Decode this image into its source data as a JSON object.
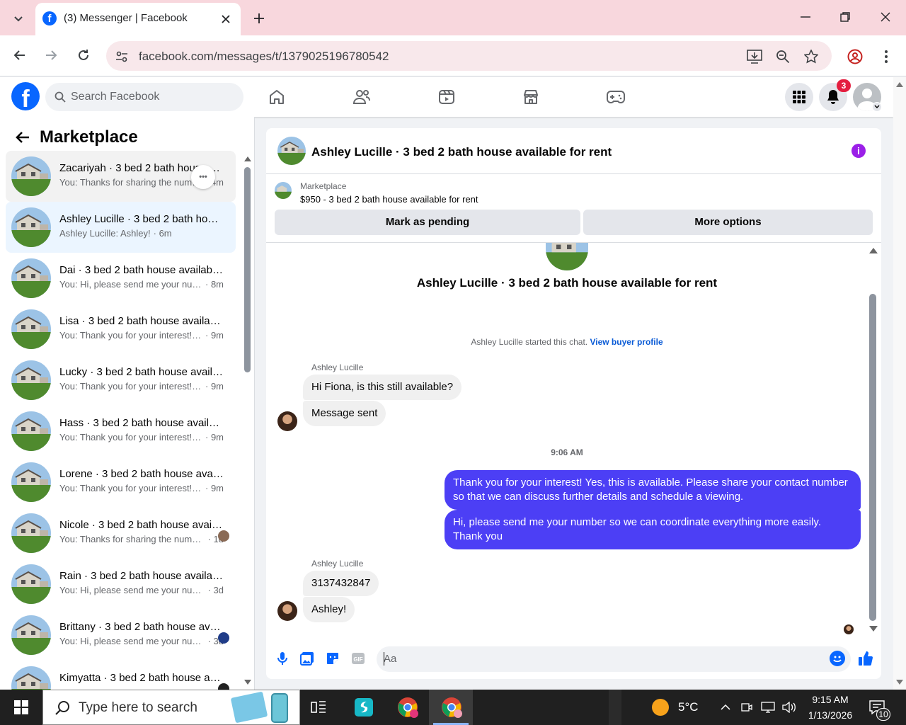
{
  "browser": {
    "tab_title": "(3) Messenger | Facebook",
    "url": "facebook.com/messages/t/1379025196780542"
  },
  "header": {
    "search_placeholder": "Search Facebook",
    "notification_count": "3"
  },
  "sidebar": {
    "title": "Marketplace",
    "conversations": [
      {
        "name": "Zacariyah · 3 bed 2 bath house available for rent",
        "snippet": "You: Thanks for sharing the number",
        "time": "· 4m",
        "active": false
      },
      {
        "name": "Ashley Lucille · 3 bed 2 bath house available for rent",
        "snippet": "Ashley Lucille: Ashley!",
        "time": "· 6m",
        "active": true
      },
      {
        "name": "Dai · 3 bed 2 bath house available for rent",
        "snippet": "You: Hi, please send me your number so we can coordinate",
        "time": "· 8m",
        "active": false
      },
      {
        "name": "Lisa · 3 bed 2 bath house available for rent",
        "snippet": "You: Thank you for your interest! Yes, this is available",
        "time": "· 9m",
        "active": false
      },
      {
        "name": "Lucky · 3 bed 2 bath house available for rent",
        "snippet": "You: Thank you for your interest! Yes, this is available",
        "time": "· 9m",
        "active": false
      },
      {
        "name": "Hass · 3 bed 2 bath house available for rent",
        "snippet": "You: Thank you for your interest! Yes, this is available",
        "time": "· 9m",
        "active": false
      },
      {
        "name": "Lorene · 3 bed 2 bath house available for rent",
        "snippet": "You: Thank you for your interest! Yes, this is available",
        "time": "· 9m",
        "active": false
      },
      {
        "name": "Nicole · 3 bed 2 bath house available for rent",
        "snippet": "You: Thanks for sharing the number",
        "time": "· 1d",
        "active": false
      },
      {
        "name": "Rain · 3 bed 2 bath house available for rent",
        "snippet": "You: Hi, please send me your number so we can coordinate",
        "time": "· 3d",
        "active": false
      },
      {
        "name": "Brittany · 3 bed 2 bath house available for rent",
        "snippet": "You: Hi, please send me your number so we can coordinate",
        "time": "· 3d",
        "active": false
      },
      {
        "name": "Kimyatta · 3 bed 2 bath house available for rent",
        "snippet": "",
        "time": "",
        "active": false
      }
    ]
  },
  "chat": {
    "title": "Ashley Lucille · 3 bed 2 bath house available for rent",
    "listing_label": "Marketplace",
    "listing_price_title": "$950 - 3 bed 2 bath house available for rent",
    "mark_pending": "Mark as pending",
    "more_options": "More options",
    "profile_title": "Ashley Lucille · 3 bed 2 bath house available for rent",
    "started_text": "Ashley Lucille started this chat.",
    "view_buyer_profile": "View buyer profile",
    "sender_name": "Ashley Lucille",
    "msg1": "Hi Fiona, is this still available?",
    "msg2": "Message sent",
    "timestamp": "9:06 AM",
    "out1": "Thank you for your interest! Yes, this is available. Please share your contact number so that we can discuss further details and schedule a viewing.",
    "out2": "Hi, please send me your number so we can coordinate everything more easily. Thank you",
    "msg3": "3137432847",
    "msg4": "Ashley!",
    "composer_placeholder": "Aa"
  },
  "taskbar": {
    "search_placeholder": "Type here to search",
    "weather": "5°C",
    "time": "9:15 AM",
    "date": "1/13/2026",
    "notifications": "10"
  },
  "colors": {
    "facebook_blue": "#0866ff",
    "outgoing_bubble": "#4c3ff5",
    "tab_strip": "#f8d7dd"
  }
}
